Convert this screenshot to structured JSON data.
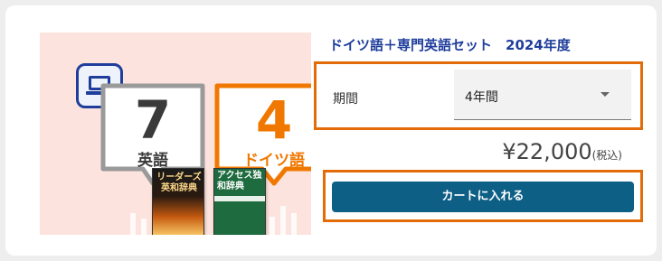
{
  "illustration": {
    "icon": "laptop-icon",
    "books": [
      {
        "count": "7",
        "language": "英語",
        "color": "#3a3a3a"
      },
      {
        "count": "4",
        "language": "ドイツ語",
        "color": "#f07800"
      }
    ],
    "covers": [
      {
        "title": "リーダーズ英和辞典"
      },
      {
        "title": "アクセス独和辞典"
      }
    ]
  },
  "product": {
    "title": "ドイツ語＋専門英語セット　2024年度"
  },
  "period": {
    "label": "期間",
    "selected": "4年間"
  },
  "price": {
    "amount": "¥22,000",
    "tax_note": "(税込)"
  },
  "cart": {
    "button_label": "カートに入れる"
  },
  "colors": {
    "accent_orange": "#e36c09",
    "title_blue": "#1f3e9c",
    "button_teal": "#0e5f86",
    "illustration_bg": "#fde3dd"
  }
}
